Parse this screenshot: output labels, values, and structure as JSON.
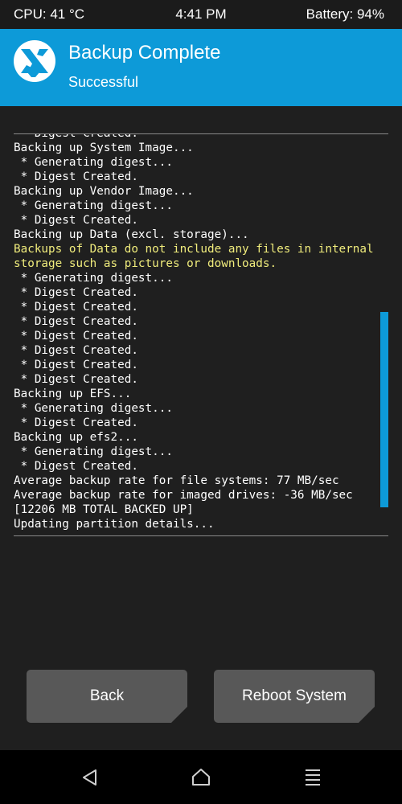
{
  "status_bar": {
    "cpu": "CPU: 41 °C",
    "time": "4:41 PM",
    "battery": "Battery: 94%"
  },
  "header": {
    "logo_icon": "twrp-logo-icon",
    "title": "Backup Complete",
    "subtitle": "Successful",
    "color": "#0d9ad8"
  },
  "console": {
    "lines": [
      {
        "text": " * Digest Created.",
        "warn": false
      },
      {
        "text": "Backing up System Image...",
        "warn": false
      },
      {
        "text": " * Generating digest...",
        "warn": false
      },
      {
        "text": " * Digest Created.",
        "warn": false
      },
      {
        "text": "Backing up Vendor Image...",
        "warn": false
      },
      {
        "text": " * Generating digest...",
        "warn": false
      },
      {
        "text": " * Digest Created.",
        "warn": false
      },
      {
        "text": "Backing up Data (excl. storage)...",
        "warn": false
      },
      {
        "text": "Backups of Data do not include any files in internal",
        "warn": true
      },
      {
        "text": "storage such as pictures or downloads.",
        "warn": true
      },
      {
        "text": " * Generating digest...",
        "warn": false
      },
      {
        "text": " * Digest Created.",
        "warn": false
      },
      {
        "text": " * Digest Created.",
        "warn": false
      },
      {
        "text": " * Digest Created.",
        "warn": false
      },
      {
        "text": " * Digest Created.",
        "warn": false
      },
      {
        "text": " * Digest Created.",
        "warn": false
      },
      {
        "text": " * Digest Created.",
        "warn": false
      },
      {
        "text": " * Digest Created.",
        "warn": false
      },
      {
        "text": "Backing up EFS...",
        "warn": false
      },
      {
        "text": " * Generating digest...",
        "warn": false
      },
      {
        "text": " * Digest Created.",
        "warn": false
      },
      {
        "text": "Backing up efs2...",
        "warn": false
      },
      {
        "text": " * Generating digest...",
        "warn": false
      },
      {
        "text": " * Digest Created.",
        "warn": false
      },
      {
        "text": "Average backup rate for file systems: 77 MB/sec",
        "warn": false
      },
      {
        "text": "Average backup rate for imaged drives: -36 MB/sec",
        "warn": false
      },
      {
        "text": "[12206 MB TOTAL BACKED UP]",
        "warn": false
      },
      {
        "text": "Updating partition details...",
        "warn": false
      }
    ],
    "text_color": "#ffffff",
    "warn_color": "#f0ec7c"
  },
  "buttons": {
    "back_label": "Back",
    "reboot_label": "Reboot System"
  },
  "nav_bar": {
    "back_icon": "triangle-back-icon",
    "home_icon": "home-icon",
    "menu_icon": "menu-icon"
  }
}
